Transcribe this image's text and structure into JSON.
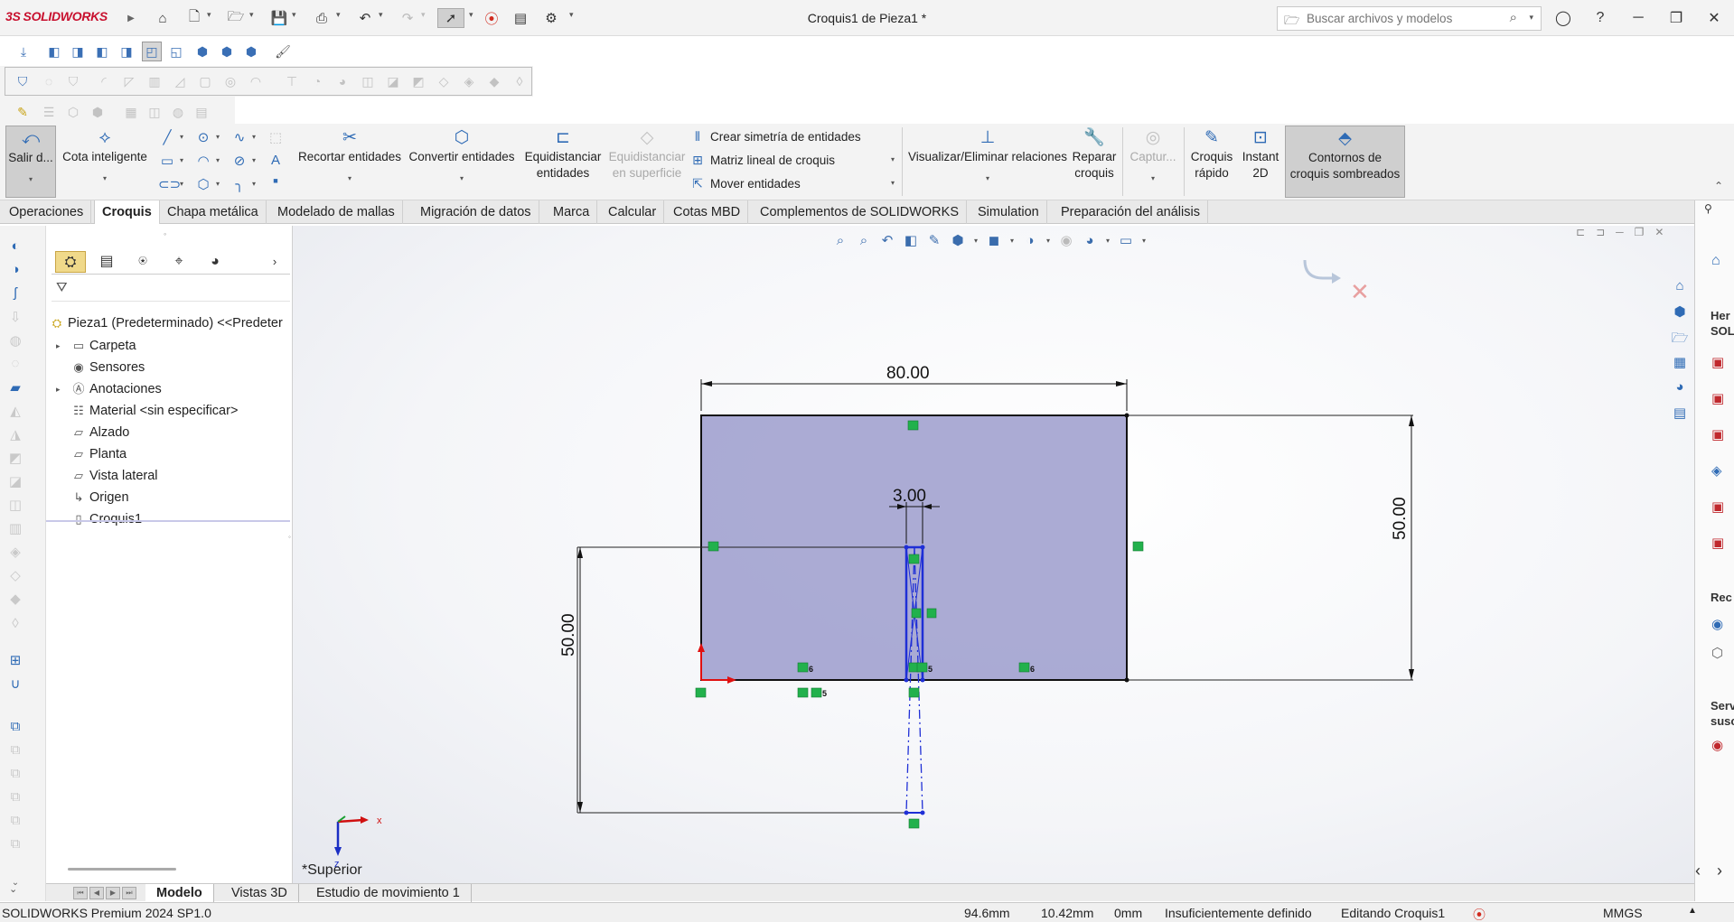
{
  "app": {
    "logo_ds": "3S",
    "logo_name": "SOLIDWORKS",
    "doc_title": "Croquis1 de Pieza1 *"
  },
  "search": {
    "placeholder": "Buscar archivos y modelos"
  },
  "command_manager": {
    "exit_sketch": "Salir d...",
    "smart_dimension": "Cota inteligente",
    "trim_entities": "Recortar entidades",
    "convert_entities": "Convertir entidades",
    "offset_entities_1": "Equidistanciar",
    "offset_entities_2": "entidades",
    "offset_surface_1": "Equidistanciar",
    "offset_surface_2": "en superficie",
    "mirror_entities": "Crear simetría de entidades",
    "linear_pattern": "Matriz lineal de croquis",
    "move_entities": "Mover entidades",
    "display_relations": "Visualizar/Eliminar relaciones",
    "repair_sketch_1": "Reparar",
    "repair_sketch_2": "croquis",
    "capture": "Captur...",
    "quick_sketch_1": "Croquis",
    "quick_sketch_2": "rápido",
    "instant2d_1": "Instant",
    "instant2d_2": "2D",
    "shaded_contours_1": "Contornos de",
    "shaded_contours_2": "croquis sombreados"
  },
  "tabs": [
    "Operaciones",
    "Croquis",
    "Chapa metálica",
    "Modelado de mallas",
    "Migración de datos",
    "Marca",
    "Calcular",
    "Cotas MBD",
    "Complementos de SOLIDWORKS",
    "Simulation",
    "Preparación del análisis"
  ],
  "feature_tree": {
    "root": "Pieza1 (Predeterminado) <<Predeter",
    "items": [
      "Carpeta",
      "Sensores",
      "Anotaciones",
      "Material <sin especificar>",
      "Alzado",
      "Planta",
      "Vista lateral",
      "Origen",
      "Croquis1"
    ]
  },
  "graphics": {
    "view_name": "*Superior",
    "dim_width": "80.00",
    "dim_height_right": "50.00",
    "dim_height_left": "50.00",
    "dim_slot": "3.00",
    "triad_x": "x",
    "triad_z": "z",
    "relation_num_6": "6",
    "relation_num_5": "5"
  },
  "taskpane": {
    "label_1": "Her",
    "label_1b": "SOLI",
    "label_2": "Rec",
    "label_3": "Serv",
    "label_3b": "susc"
  },
  "bottom_tabs": [
    "Modelo",
    "Vistas 3D",
    "Estudio de movimiento 1"
  ],
  "status": {
    "product": "SOLIDWORKS Premium 2024 SP1.0",
    "x": "94.6mm",
    "y": "10.42mm",
    "z": "0mm",
    "state": "Insuficientemente definido",
    "editing": "Editando Croquis1",
    "units": "MMGS"
  },
  "colors": {
    "sketch_fill": "#9c9ccc",
    "selected_blue": "#1f2fd6",
    "relation_green": "#22b14c",
    "accent_red": "#c8102e"
  }
}
